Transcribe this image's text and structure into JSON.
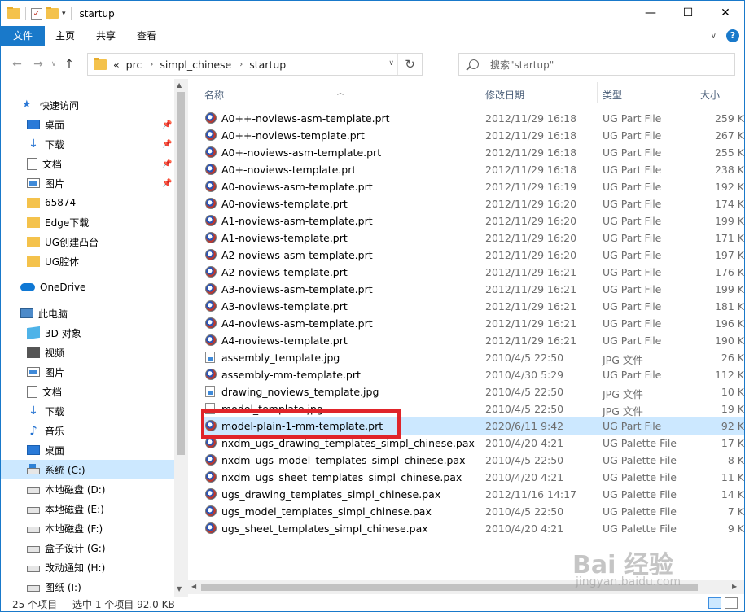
{
  "window": {
    "title": "startup",
    "controls": {
      "minimize": "—",
      "maximize": "☐",
      "close": "✕"
    }
  },
  "ribbon": {
    "tabs": [
      "文件",
      "主页",
      "共享",
      "查看"
    ],
    "help": "?"
  },
  "address": {
    "prefix": "«",
    "crumbs": [
      "prc",
      "simpl_chinese",
      "startup"
    ],
    "search_placeholder": "搜索\"startup\""
  },
  "sidebar": {
    "items": [
      {
        "label": "快速访问",
        "icon": "star-icon"
      },
      {
        "label": "桌面",
        "icon": "desktop-icon",
        "pinned": true
      },
      {
        "label": "下载",
        "icon": "download-icon",
        "pinned": true
      },
      {
        "label": "文档",
        "icon": "document-icon",
        "pinned": true
      },
      {
        "label": "图片",
        "icon": "pictures-icon",
        "pinned": true
      },
      {
        "label": "65874",
        "icon": "folder-icon"
      },
      {
        "label": "Edge下载",
        "icon": "folder-icon"
      },
      {
        "label": "UG创建凸台",
        "icon": "folder-icon"
      },
      {
        "label": "UG腔体",
        "icon": "folder-icon"
      },
      {
        "label": "OneDrive",
        "icon": "onedrive-icon"
      },
      {
        "label": "此电脑",
        "icon": "this-pc-icon"
      },
      {
        "label": "3D 对象",
        "icon": "3d-objects-icon"
      },
      {
        "label": "视频",
        "icon": "video-icon"
      },
      {
        "label": "图片",
        "icon": "pictures-icon"
      },
      {
        "label": "文档",
        "icon": "document-icon"
      },
      {
        "label": "下载",
        "icon": "download-icon"
      },
      {
        "label": "音乐",
        "icon": "music-icon"
      },
      {
        "label": "桌面",
        "icon": "desktop-icon"
      },
      {
        "label": "系统 (C:)",
        "icon": "system-drive-icon",
        "selected": true
      },
      {
        "label": "本地磁盘 (D:)",
        "icon": "drive-icon"
      },
      {
        "label": "本地磁盘 (E:)",
        "icon": "drive-icon"
      },
      {
        "label": "本地磁盘 (F:)",
        "icon": "drive-icon"
      },
      {
        "label": "盒子设计 (G:)",
        "icon": "drive-icon"
      },
      {
        "label": "改动通知 (H:)",
        "icon": "drive-icon"
      },
      {
        "label": "图纸 (I:)",
        "icon": "drive-icon"
      }
    ]
  },
  "columns": {
    "name": "名称",
    "date": "修改日期",
    "type": "类型",
    "size": "大小"
  },
  "files": [
    {
      "name": "A0++-noviews-asm-template.prt",
      "date": "2012/11/29 16:18",
      "type": "UG Part File",
      "size": "259 K",
      "kind": "ug"
    },
    {
      "name": "A0++-noviews-template.prt",
      "date": "2012/11/29 16:18",
      "type": "UG Part File",
      "size": "267 K",
      "kind": "ug"
    },
    {
      "name": "A0+-noviews-asm-template.prt",
      "date": "2012/11/29 16:18",
      "type": "UG Part File",
      "size": "255 K",
      "kind": "ug"
    },
    {
      "name": "A0+-noviews-template.prt",
      "date": "2012/11/29 16:18",
      "type": "UG Part File",
      "size": "238 K",
      "kind": "ug"
    },
    {
      "name": "A0-noviews-asm-template.prt",
      "date": "2012/11/29 16:19",
      "type": "UG Part File",
      "size": "192 K",
      "kind": "ug"
    },
    {
      "name": "A0-noviews-template.prt",
      "date": "2012/11/29 16:20",
      "type": "UG Part File",
      "size": "174 K",
      "kind": "ug"
    },
    {
      "name": "A1-noviews-asm-template.prt",
      "date": "2012/11/29 16:20",
      "type": "UG Part File",
      "size": "199 K",
      "kind": "ug"
    },
    {
      "name": "A1-noviews-template.prt",
      "date": "2012/11/29 16:20",
      "type": "UG Part File",
      "size": "171 K",
      "kind": "ug"
    },
    {
      "name": "A2-noviews-asm-template.prt",
      "date": "2012/11/29 16:20",
      "type": "UG Part File",
      "size": "197 K",
      "kind": "ug"
    },
    {
      "name": "A2-noviews-template.prt",
      "date": "2012/11/29 16:21",
      "type": "UG Part File",
      "size": "176 K",
      "kind": "ug"
    },
    {
      "name": "A3-noviews-asm-template.prt",
      "date": "2012/11/29 16:21",
      "type": "UG Part File",
      "size": "199 K",
      "kind": "ug"
    },
    {
      "name": "A3-noviews-template.prt",
      "date": "2012/11/29 16:21",
      "type": "UG Part File",
      "size": "181 K",
      "kind": "ug"
    },
    {
      "name": "A4-noviews-asm-template.prt",
      "date": "2012/11/29 16:21",
      "type": "UG Part File",
      "size": "196 K",
      "kind": "ug"
    },
    {
      "name": "A4-noviews-template.prt",
      "date": "2012/11/29 16:21",
      "type": "UG Part File",
      "size": "190 K",
      "kind": "ug"
    },
    {
      "name": "assembly_template.jpg",
      "date": "2010/4/5 22:50",
      "type": "JPG 文件",
      "size": "26 K",
      "kind": "jpg"
    },
    {
      "name": "assembly-mm-template.prt",
      "date": "2010/4/30 5:29",
      "type": "UG Part File",
      "size": "112 K",
      "kind": "ug"
    },
    {
      "name": "drawing_noviews_template.jpg",
      "date": "2010/4/5 22:50",
      "type": "JPG 文件",
      "size": "10 K",
      "kind": "jpg"
    },
    {
      "name": "model_template.jpg",
      "date": "2010/4/5 22:50",
      "type": "JPG 文件",
      "size": "19 K",
      "kind": "jpg"
    },
    {
      "name": "model-plain-1-mm-template.prt",
      "date": "2020/6/11 9:42",
      "type": "UG Part File",
      "size": "92 K",
      "kind": "ug",
      "selected": true
    },
    {
      "name": "nxdm_ugs_drawing_templates_simpl_chinese.pax",
      "date": "2010/4/20 4:21",
      "type": "UG Palette File",
      "size": "17 K",
      "kind": "ug"
    },
    {
      "name": "nxdm_ugs_model_templates_simpl_chinese.pax",
      "date": "2010/4/5 22:50",
      "type": "UG Palette File",
      "size": "8 K",
      "kind": "ug"
    },
    {
      "name": "nxdm_ugs_sheet_templates_simpl_chinese.pax",
      "date": "2010/4/20 4:21",
      "type": "UG Palette File",
      "size": "11 K",
      "kind": "ug"
    },
    {
      "name": "ugs_drawing_templates_simpl_chinese.pax",
      "date": "2012/11/16 14:17",
      "type": "UG Palette File",
      "size": "14 K",
      "kind": "ug"
    },
    {
      "name": "ugs_model_templates_simpl_chinese.pax",
      "date": "2010/4/5 22:50",
      "type": "UG Palette File",
      "size": "7 K",
      "kind": "ug"
    },
    {
      "name": "ugs_sheet_templates_simpl_chinese.pax",
      "date": "2010/4/20 4:21",
      "type": "UG Palette File",
      "size": "9 K",
      "kind": "ug"
    }
  ],
  "status": {
    "count": "25 个项目",
    "selection": "选中 1 个项目  92.0 KB"
  },
  "watermark": {
    "main": "Bai 经验",
    "sub": "jingyan.baidu.com"
  },
  "colors": {
    "accent": "#1979ca",
    "selection": "#cce8ff",
    "highlight_box": "#e0242a"
  }
}
